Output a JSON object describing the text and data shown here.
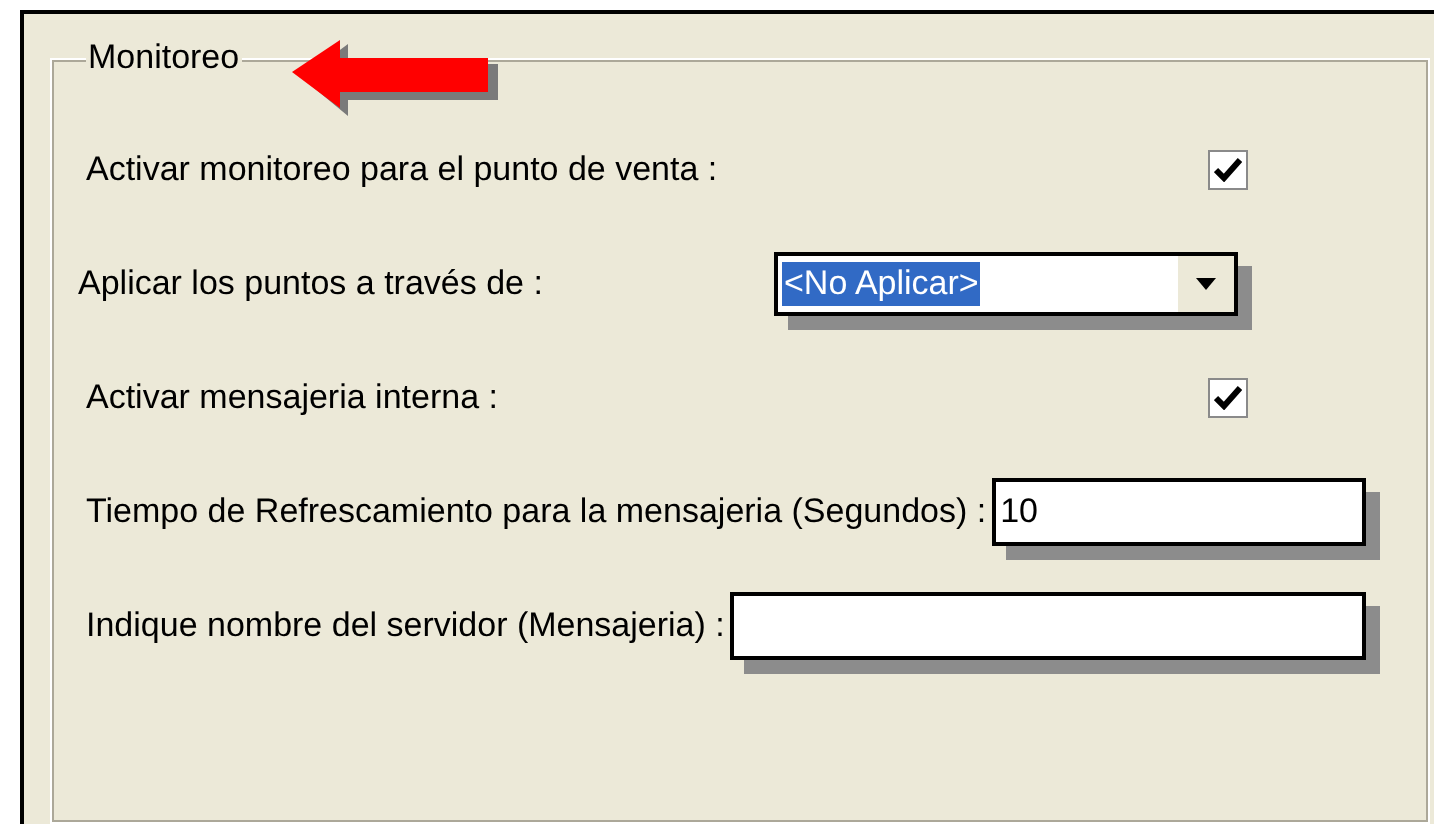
{
  "group": {
    "title": "Monitoreo"
  },
  "rows": [
    {
      "kind": "checkbox",
      "label": "Activar monitoreo para el punto de venta :",
      "checked": true
    },
    {
      "kind": "select",
      "label": "Aplicar los puntos  a través de :",
      "value": "<No Aplicar>"
    },
    {
      "kind": "checkbox",
      "label": "Activar mensajeria interna :",
      "checked": true
    },
    {
      "kind": "text",
      "label": "Tiempo de Refrescamiento para la mensajeria (Segundos) :",
      "value": "10"
    },
    {
      "kind": "text",
      "label": "Indique nombre del servidor (Mensajeria) :",
      "value": ""
    }
  ]
}
